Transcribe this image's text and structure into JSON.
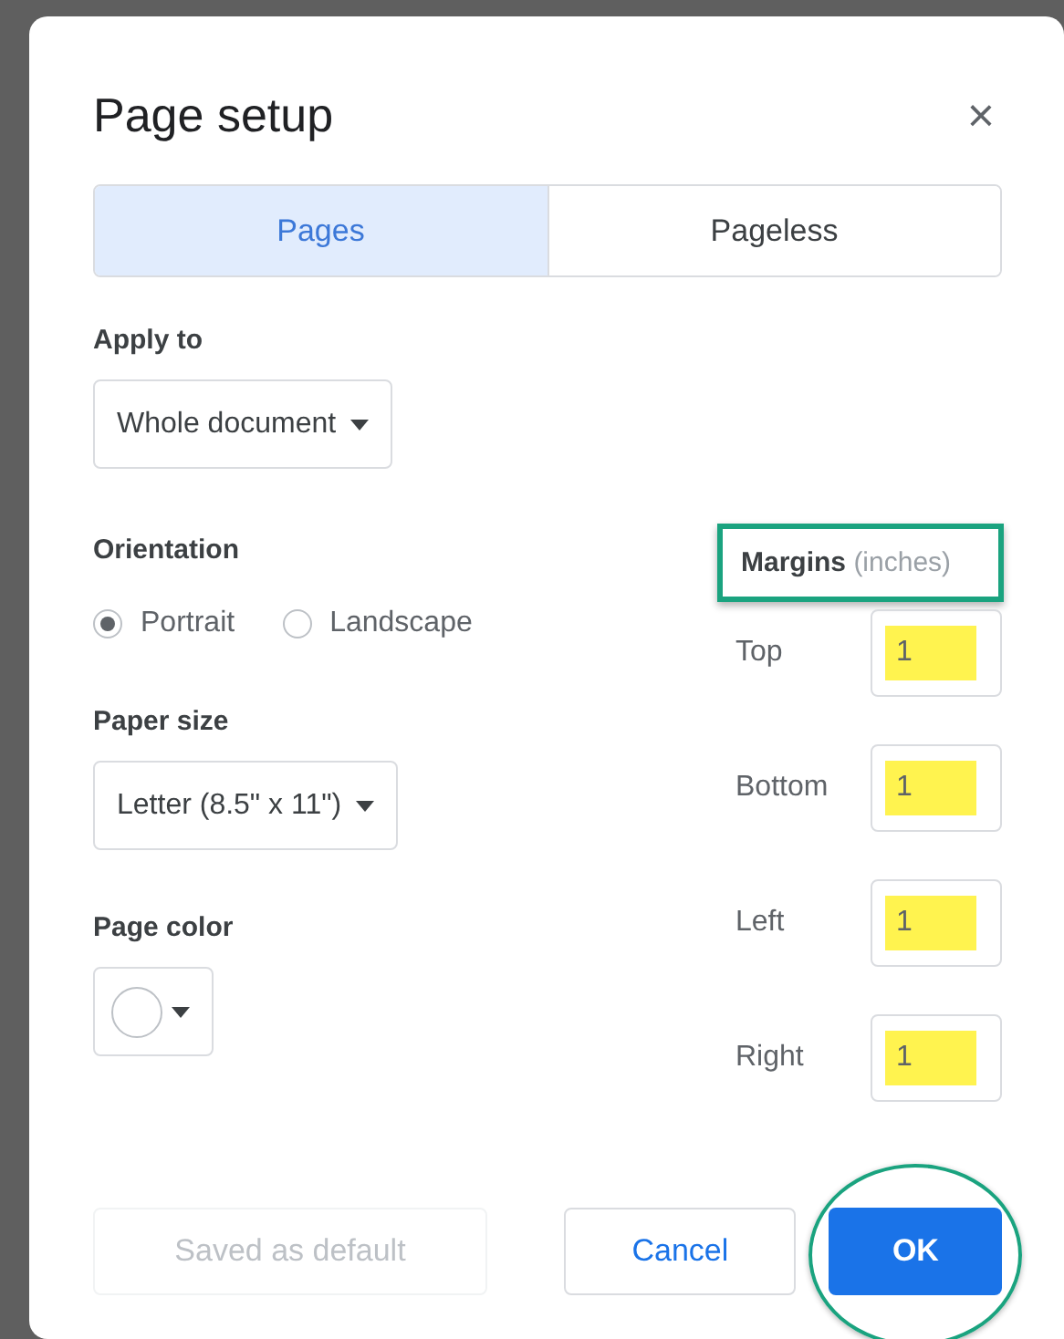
{
  "dialog": {
    "title": "Page setup",
    "close_icon": "×"
  },
  "tabs": [
    {
      "label": "Pages",
      "selected": true
    },
    {
      "label": "Pageless",
      "selected": false
    }
  ],
  "apply_to": {
    "label": "Apply to",
    "value": "Whole document"
  },
  "orientation": {
    "label": "Orientation",
    "options": [
      {
        "label": "Portrait",
        "selected": true
      },
      {
        "label": "Landscape",
        "selected": false
      }
    ]
  },
  "paper_size": {
    "label": "Paper size",
    "value": "Letter (8.5\" x 11\")"
  },
  "page_color": {
    "label": "Page color",
    "color": "#ffffff"
  },
  "margins": {
    "label": "Margins",
    "unit": "(inches)",
    "outlined": true,
    "fields": [
      {
        "label": "Top",
        "value": "1",
        "highlighted": true
      },
      {
        "label": "Bottom",
        "value": "1",
        "highlighted": true
      },
      {
        "label": "Left",
        "value": "1",
        "highlighted": true
      },
      {
        "label": "Right",
        "value": "1",
        "highlighted": true
      }
    ]
  },
  "buttons": [
    {
      "kind": "disabled",
      "label": "Saved as default"
    },
    {
      "kind": "secondary",
      "label": "Cancel"
    },
    {
      "kind": "primary",
      "label": "OK",
      "circled": true
    }
  ]
}
